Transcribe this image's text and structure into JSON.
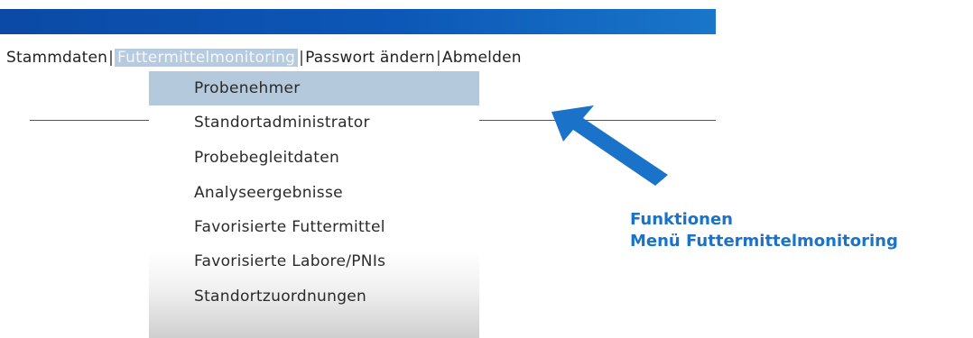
{
  "nav": {
    "items": [
      "Stammdaten",
      "Futtermittelmonitoring",
      "Passwort ändern",
      "Abmelden"
    ],
    "separator": "|"
  },
  "dropdown": {
    "items": [
      "Probenehmer",
      "Standortadministrator",
      "Probebegleitdaten",
      "Analyseergebnisse",
      "Favorisierte Futtermittel",
      "Favorisierte Labore/PNIs",
      "Standortzuordnungen"
    ]
  },
  "annotation": {
    "line1": "Funktionen",
    "line2": "Menü Futtermittelmonitoring",
    "color": "#1a73c8"
  },
  "colors": {
    "header_bar": "#0c57b7",
    "active_highlight": "#b5c9dd",
    "arrow": "#1a73c8"
  },
  "icons": {
    "pointer": "arrow-icon"
  }
}
